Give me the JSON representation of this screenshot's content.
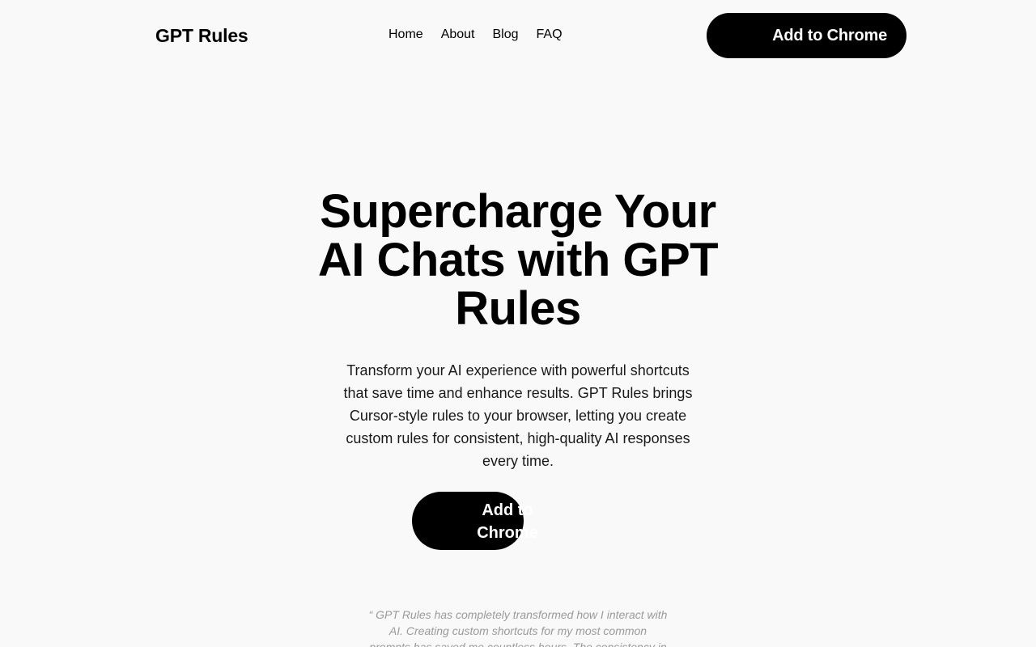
{
  "header": {
    "logo": "GPT Rules",
    "nav": [
      {
        "label": "Home"
      },
      {
        "label": "About"
      },
      {
        "label": "Blog"
      },
      {
        "label": "FAQ"
      }
    ],
    "cta_label": "Add to Chrome"
  },
  "hero": {
    "title": "Supercharge Your AI Chats with GPT Rules",
    "description": "Transform your AI experience with powerful shortcuts that save time and enhance results. GPT Rules brings Cursor-style rules to your browser, letting you create custom rules for consistent, high-quality AI responses every time.",
    "cta_label": "Add to Chrome"
  },
  "testimonial": {
    "quote": "“ GPT Rules has completely transformed how I interact with AI. Creating custom shortcuts for my most common prompts has saved me countless hours. The consistency in"
  },
  "colors": {
    "background": "#f9f9f9",
    "primary": "#000000",
    "on_primary": "#ffffff",
    "muted_text": "#9a9a9a"
  }
}
